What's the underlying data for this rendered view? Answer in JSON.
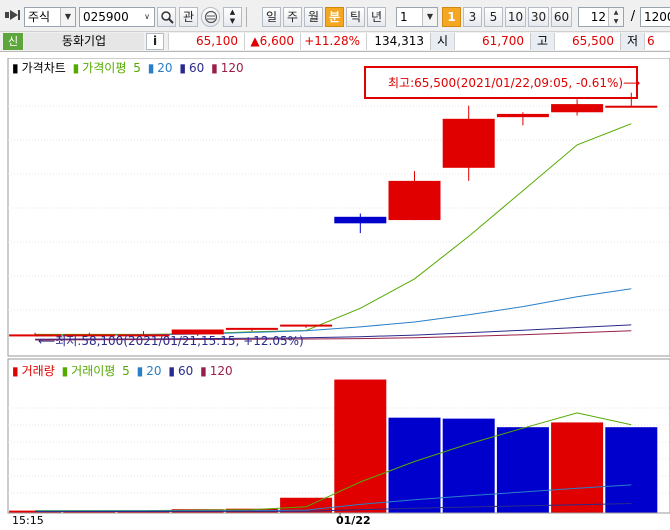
{
  "toolbar": {
    "market": "주식",
    "code": "025900",
    "watch_label": "관",
    "periods": [
      "일",
      "주",
      "월",
      "분",
      "틱",
      "년"
    ],
    "active_period": "분",
    "interval": "1",
    "minute_buttons": [
      "1",
      "3",
      "5",
      "10",
      "30",
      "60"
    ],
    "active_minute": "1",
    "count": "12",
    "divider": "/",
    "total": "1200"
  },
  "quote": {
    "badge": "신",
    "name": "동화기업",
    "info_label": "i",
    "price": "65,100",
    "change": "▲6,600",
    "change_pct": "+11.28%",
    "volume": "134,313",
    "open_label": "시",
    "open": "61,700",
    "high_label": "고",
    "high": "65,500",
    "low_label": "저",
    "low": "6"
  },
  "price_panel": {
    "legend": {
      "title": "가격차트",
      "ma_label": "가격이평",
      "ma": [
        "5",
        "20",
        "60",
        "120"
      ]
    },
    "high_annotation": "최고:65,500(2021/01/22,09:05, -0.61%)⟶",
    "low_annotation": "⟵최저:58,100(2021/01/21,15:15, +12.05%)"
  },
  "volume_panel": {
    "legend": {
      "title": "거래량",
      "ma_label": "거래이평",
      "ma": [
        "5",
        "20",
        "60",
        "120"
      ]
    }
  },
  "x_axis": {
    "left_label": "15:15",
    "date_label": "01/22"
  },
  "colors": {
    "up": "#e00000",
    "down": "#0000cc",
    "ma5": "#55aa00",
    "ma20": "#2a7fc8",
    "ma60": "#2a2a8c",
    "ma120": "#9a1e4a",
    "annotation_box": "#e00000"
  },
  "chart_data": [
    {
      "type": "candlestick",
      "title": "가격차트",
      "ylim": [
        57500,
        66500
      ],
      "candles": [
        {
          "o": 58100,
          "h": 58150,
          "l": 58050,
          "c": 58100
        },
        {
          "o": 58100,
          "h": 58150,
          "l": 58050,
          "c": 58100
        },
        {
          "o": 58100,
          "h": 58200,
          "l": 58050,
          "c": 58100
        },
        {
          "o": 58100,
          "h": 58250,
          "l": 58050,
          "c": 58250
        },
        {
          "o": 58250,
          "h": 58300,
          "l": 58200,
          "c": 58300
        },
        {
          "o": 58350,
          "h": 58400,
          "l": 58300,
          "c": 58400
        },
        {
          "o": 61700,
          "h": 61800,
          "l": 61200,
          "c": 61500
        },
        {
          "o": 61600,
          "h": 63100,
          "l": 61600,
          "c": 62800
        },
        {
          "o": 63200,
          "h": 65100,
          "l": 62800,
          "c": 64700
        },
        {
          "o": 64750,
          "h": 64900,
          "l": 64500,
          "c": 64850
        },
        {
          "o": 64900,
          "h": 65300,
          "l": 64800,
          "c": 65150
        },
        {
          "o": 65100,
          "h": 65500,
          "l": 65050,
          "c": 65100
        }
      ],
      "series": [
        {
          "name": "5",
          "values": [
            58100,
            58100,
            58100,
            58120,
            58180,
            58220,
            58900,
            59800,
            61100,
            62500,
            63900,
            64550
          ]
        },
        {
          "name": "20",
          "values": [
            58050,
            58070,
            58090,
            58110,
            58160,
            58210,
            58330,
            58480,
            58700,
            58950,
            59250,
            59500
          ]
        },
        {
          "name": "60",
          "values": [
            57950,
            57960,
            57960,
            57970,
            57980,
            58000,
            58030,
            58080,
            58150,
            58230,
            58310,
            58390
          ]
        },
        {
          "name": "120",
          "values": [
            57930,
            57935,
            57940,
            57945,
            57950,
            57960,
            57970,
            58000,
            58040,
            58090,
            58150,
            58210
          ]
        }
      ]
    },
    {
      "type": "bar",
      "title": "거래량",
      "ylim": [
        0,
        30000
      ],
      "values": [
        500,
        500,
        500,
        800,
        900,
        3200,
        28000,
        20000,
        19800,
        18000,
        19000,
        18000
      ],
      "up": [
        true,
        true,
        true,
        true,
        true,
        true,
        true,
        false,
        false,
        false,
        true,
        false
      ],
      "series": [
        {
          "name": "5",
          "values": [
            500,
            500,
            500,
            600,
            700,
            1300,
            6500,
            10800,
            14500,
            17800,
            21000,
            18500
          ]
        },
        {
          "name": "20",
          "values": [
            400,
            420,
            440,
            460,
            480,
            600,
            1800,
            2800,
            3600,
            4400,
            5200,
            5900
          ]
        },
        {
          "name": "60",
          "values": [
            300,
            310,
            320,
            330,
            340,
            380,
            700,
            1000,
            1250,
            1500,
            1750,
            2000
          ]
        }
      ]
    }
  ]
}
